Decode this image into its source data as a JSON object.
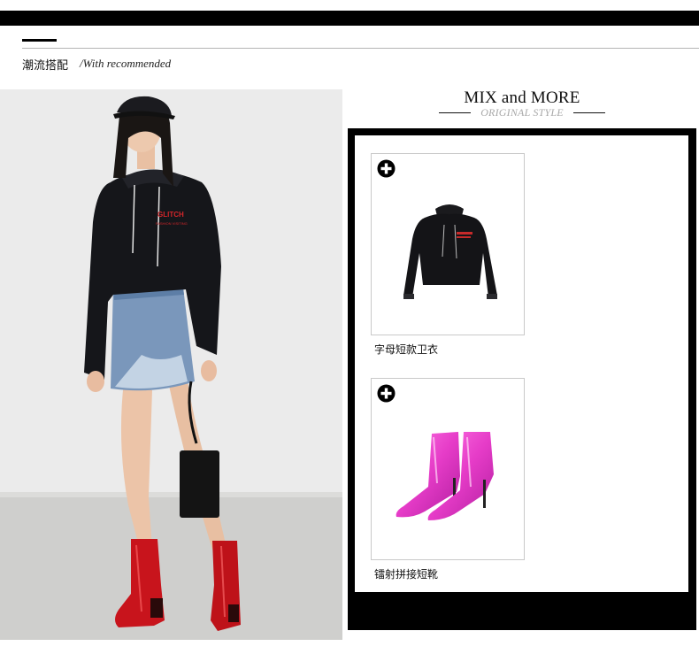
{
  "section": {
    "title_cn": "潮流搭配",
    "title_en": "/With recommended"
  },
  "mix": {
    "title": "MIX and MORE",
    "subtitle": "ORIGINAL STYLE"
  },
  "products": [
    {
      "name": "字母短款卫衣",
      "icon": "plus-circle-icon",
      "image": "black-cropped-hoodie"
    },
    {
      "name": "镭射拼接短靴",
      "icon": "plus-circle-icon",
      "image": "metallic-pink-ankle-boots"
    }
  ],
  "model_photo": {
    "hoodie_text": "GLITCH",
    "hoodie_subtext": "FASHION VISITING"
  },
  "colors": {
    "accent_black": "#000000",
    "hoodie_print_red": "#d4262a",
    "boot_red": "#c8141c",
    "boot_pink": "#e63cc8",
    "denim_blue": "#6f8fb3"
  }
}
